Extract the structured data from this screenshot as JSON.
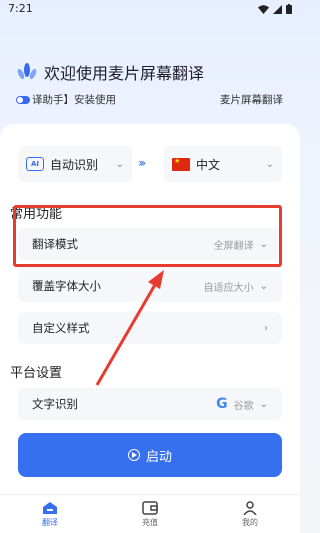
{
  "status_bar": {
    "time": "7:21"
  },
  "hero": {
    "title": "欢迎使用麦片屏幕翻译"
  },
  "marquee": {
    "left_text": "译助手】安装使用",
    "right_text": "麦片屏幕翻译"
  },
  "lang": {
    "from": "自动识别",
    "to": "中文"
  },
  "sections": {
    "common": "常用功能",
    "platform": "平台设置"
  },
  "options": {
    "mode": {
      "label": "翻译模式",
      "value": "全屏翻译"
    },
    "size": {
      "label": "覆盖字体大小",
      "value": "自适应大小"
    },
    "style": {
      "label": "自定义样式"
    },
    "ocr": {
      "label": "文字识别",
      "value": "谷歌",
      "logo": "G"
    }
  },
  "start_button": {
    "label": "启动"
  },
  "nav": [
    {
      "label": "翻译",
      "active": true
    },
    {
      "label": "充值",
      "active": false
    },
    {
      "label": "我的",
      "active": false
    }
  ],
  "colors": {
    "accent": "#3670ee",
    "annotation": "#e63b2e"
  }
}
